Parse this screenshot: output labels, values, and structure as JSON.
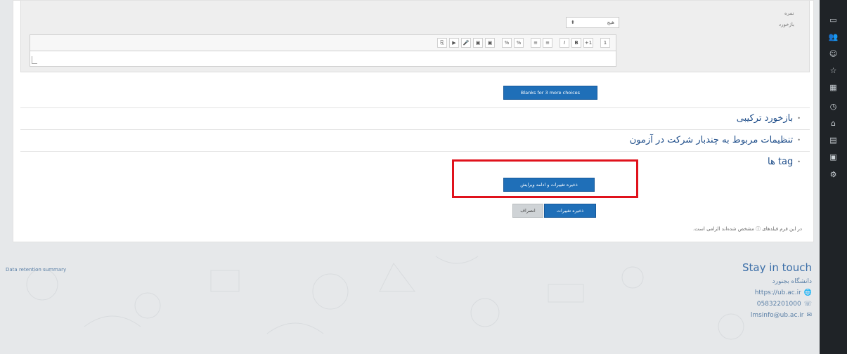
{
  "form": {
    "grade_label": "نمره",
    "feedback_label": "بازخورد",
    "grade_select": {
      "value": "هیچ",
      "chevron": "chevron-down-icon"
    },
    "toolbar_icons": [
      "1",
      "+1",
      "B",
      "I",
      "≡",
      "≡",
      "%",
      "%",
      "▣",
      "▣",
      "🎤",
      "▶",
      "⎘"
    ]
  },
  "buttons": {
    "blanks": "Blanks for 3 more choices",
    "save_continue": "ذخیره تغییرات و ادامه ویرایش",
    "save": "ذخیره تغییرات",
    "cancel": "انصراف"
  },
  "sections": [
    {
      "label": "بازخورد ترکیبی"
    },
    {
      "label": "تنظیمات مربوط به چندبار شرکت در آزمون"
    },
    {
      "label": "tag ها"
    }
  ],
  "required_note": "در این فرم فیلدهای ⓘ مشخص شده‌اند الزامی است.",
  "footer": {
    "data_retention": "Data retention summary",
    "stay_title": "Stay in touch",
    "org": "دانشگاه بجنورد",
    "website": "https://ub.ac.ir",
    "phone": "05832201000",
    "email": "lmsinfo@ub.ac.ir"
  },
  "sidebar_icons": [
    "folder-icon",
    "users-icon",
    "person-icon",
    "star-icon",
    "grid-icon",
    "clock-icon",
    "home-icon",
    "calendar-icon",
    "archive-icon",
    "gear-icon"
  ]
}
